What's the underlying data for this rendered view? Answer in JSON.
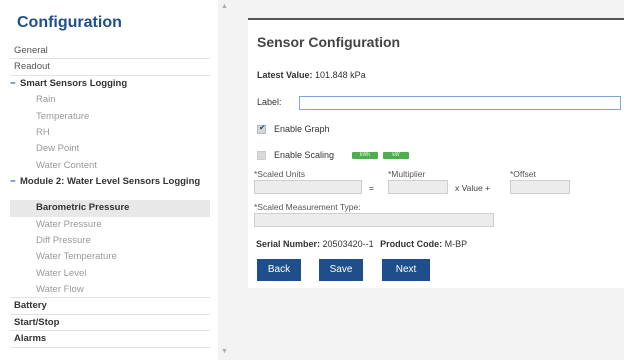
{
  "sidebar": {
    "title": "Configuration",
    "top_items": [
      "General",
      "Readout"
    ],
    "group1": {
      "label": "Smart Sensors Logging",
      "items": [
        "Rain",
        "Temperature",
        "RH",
        "Dew Point",
        "Water Content"
      ]
    },
    "group2": {
      "label": "Module 2: Water Level Sensors Logging",
      "items": [
        "Barometric Pressure",
        "Water Pressure",
        "Diff Pressure",
        "Water Temperature",
        "Water Level",
        "Water Flow"
      ],
      "active_index": 0
    },
    "bottom_items": [
      "Battery",
      "Start/Stop",
      "Alarms"
    ]
  },
  "panel": {
    "title": "Sensor Configuration",
    "latest_label": "Latest Value:",
    "latest_value": "101.848 kPa",
    "label_label": "Label:",
    "label_value": "",
    "enable_graph_label": "Enable Graph",
    "enable_graph_checked": true,
    "enable_scaling_label": "Enable Scaling",
    "enable_scaling_checked": false,
    "badge1": "kWh",
    "badge2": "kW",
    "scaled_units_label": "*Scaled Units",
    "equals": "=",
    "multiplier_label": "*Multiplier",
    "x_value": "x Value +",
    "offset_label": "*Offset",
    "scaled_type_label": "*Scaled Measurement Type:",
    "serial_label": "Serial Number:",
    "serial_value": "20503420--1",
    "product_label": "Product Code:",
    "product_value": "M-BP",
    "back_label": "Back",
    "save_label": "Save",
    "next_label": "Next"
  },
  "colors": {
    "accent": "#1f4f8a",
    "badge": "#4cae4c"
  }
}
